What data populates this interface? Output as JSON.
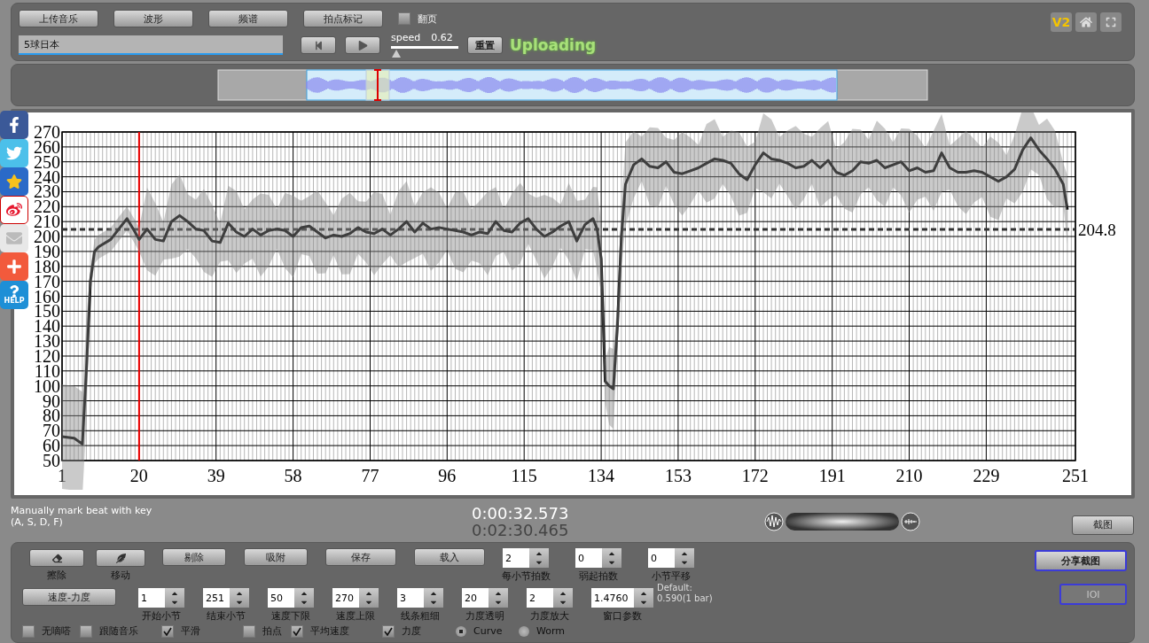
{
  "toolbar": {
    "tabs": [
      "上传音乐",
      "波形",
      "频谱",
      "拍点标记"
    ],
    "page_toggle": {
      "label": "翻页",
      "checked": false
    },
    "title_field": {
      "value": "5球日本"
    },
    "speed": {
      "label": "speed",
      "reading": "0.62",
      "level": 0.04
    },
    "reset_button": "重置",
    "status": "Uploading",
    "badge": "V2"
  },
  "side_share": {
    "help_label": "HELP"
  },
  "chart": {
    "chart_data": {
      "type": "line",
      "xlim": [
        1,
        251
      ],
      "ylim": [
        50,
        270
      ],
      "xticks": [
        1,
        20,
        39,
        58,
        77,
        96,
        115,
        134,
        153,
        172,
        191,
        210,
        229,
        251
      ],
      "yticks": [
        50,
        60,
        70,
        80,
        90,
        100,
        110,
        120,
        130,
        140,
        150,
        160,
        170,
        180,
        190,
        200,
        210,
        220,
        230,
        240,
        250,
        260,
        270
      ],
      "x": [
        1,
        4,
        6,
        7,
        8,
        9,
        10,
        13,
        15,
        17,
        19,
        20,
        22,
        24,
        26,
        28,
        30,
        32,
        34,
        36,
        38,
        40,
        42,
        44,
        46,
        48,
        50,
        52,
        54,
        56,
        58,
        60,
        62,
        64,
        66,
        68,
        70,
        72,
        74,
        76,
        78,
        80,
        82,
        84,
        86,
        88,
        90,
        92,
        94,
        96,
        98,
        100,
        102,
        104,
        106,
        108,
        110,
        112,
        114,
        116,
        118,
        120,
        122,
        124,
        126,
        128,
        130,
        132,
        133,
        134,
        135,
        136,
        137,
        138,
        139,
        140,
        142,
        144,
        146,
        148,
        150,
        152,
        154,
        156,
        158,
        160,
        162,
        164,
        166,
        168,
        170,
        172,
        174,
        176,
        178,
        180,
        182,
        184,
        186,
        188,
        190,
        192,
        194,
        196,
        198,
        200,
        202,
        204,
        206,
        208,
        210,
        212,
        214,
        216,
        218,
        220,
        222,
        224,
        226,
        228,
        230,
        232,
        234,
        236,
        238,
        240,
        242,
        244,
        246,
        248,
        249
      ],
      "series": [
        {
          "color": "#000000",
          "values": [
            66,
            65,
            61,
            110,
            170,
            190,
            193,
            198,
            205,
            212,
            203,
            198,
            205,
            198,
            197,
            210,
            214,
            210,
            205,
            204,
            197,
            196,
            209,
            203,
            200,
            205,
            201,
            204,
            205,
            204,
            200,
            206,
            207,
            203,
            199,
            201,
            200,
            202,
            206,
            203,
            202,
            205,
            201,
            205,
            210,
            203,
            209,
            205,
            206,
            205,
            204,
            203,
            201,
            203,
            202,
            210,
            204,
            203,
            209,
            212,
            205,
            200,
            203,
            207,
            210,
            197,
            208,
            212,
            205,
            185,
            103,
            100,
            98,
            140,
            200,
            235,
            248,
            252,
            247,
            246,
            250,
            243,
            242,
            244,
            246,
            249,
            252,
            251,
            249,
            242,
            238,
            248,
            256,
            252,
            251,
            249,
            246,
            247,
            251,
            246,
            251,
            243,
            241,
            244,
            250,
            249,
            251,
            246,
            248,
            250,
            244,
            246,
            243,
            244,
            256,
            246,
            243,
            243,
            244,
            243,
            240,
            237,
            240,
            245,
            258,
            266,
            258,
            252,
            245,
            235,
            218
          ]
        }
      ],
      "grid": true,
      "ref_lines": [
        {
          "axis": "y",
          "value": 204.8,
          "label": "204.8",
          "color": "#333333"
        },
        {
          "axis": "x",
          "value": 20,
          "color": "#ee0000"
        }
      ]
    }
  },
  "info": {
    "hint_lines": [
      "Manually mark beat with key",
      "(A, S, D, F)"
    ],
    "position": "0:00:32.573",
    "duration": "0:02:30.465",
    "snapshot_button": "截图"
  },
  "controls": {
    "tool_buttons": [
      {
        "kind": "eraser",
        "label": "擦除"
      },
      {
        "kind": "move",
        "label": "移动"
      }
    ],
    "action_buttons": [
      "剔除",
      "吸附",
      "保存",
      "载入"
    ],
    "row1_spinners": [
      {
        "value": "2",
        "label": "每小节拍数"
      },
      {
        "value": "0",
        "label": "弱起拍数"
      },
      {
        "value": "0",
        "label": "小节平移"
      }
    ],
    "mode_button": "速度-力度",
    "row2_spinners": [
      {
        "value": "1",
        "label": "开始小节"
      },
      {
        "value": "251",
        "label": "结束小节"
      },
      {
        "value": "50",
        "label": "速度下限"
      },
      {
        "value": "270",
        "label": "速度上限"
      },
      {
        "value": "3",
        "label": "线条粗细"
      },
      {
        "value": "20",
        "label": "力度透明"
      },
      {
        "value": "2",
        "label": "力度放大"
      },
      {
        "value": "1.4760",
        "label": "窗口参数"
      }
    ],
    "default_note": [
      "Default:",
      "0.590(1 bar)"
    ],
    "options": [
      {
        "kind": "checkbox",
        "label": "无嘀嗒",
        "checked": false
      },
      {
        "kind": "checkbox",
        "label": "跟随音乐",
        "checked": false
      },
      {
        "kind": "checkbox",
        "label": "平滑",
        "checked": true
      },
      {
        "kind": "checkbox",
        "label": "拍点",
        "checked": false
      },
      {
        "kind": "checkbox",
        "label": "平均速度",
        "checked": true
      },
      {
        "kind": "checkbox",
        "label": "力度",
        "checked": true
      },
      {
        "kind": "radio",
        "label": "Curve",
        "selected": true
      },
      {
        "kind": "radio",
        "label": "Worm",
        "selected": false
      }
    ],
    "share_button": "分享截图",
    "ioi_button": {
      "label": "IOI",
      "disabled": true
    }
  }
}
